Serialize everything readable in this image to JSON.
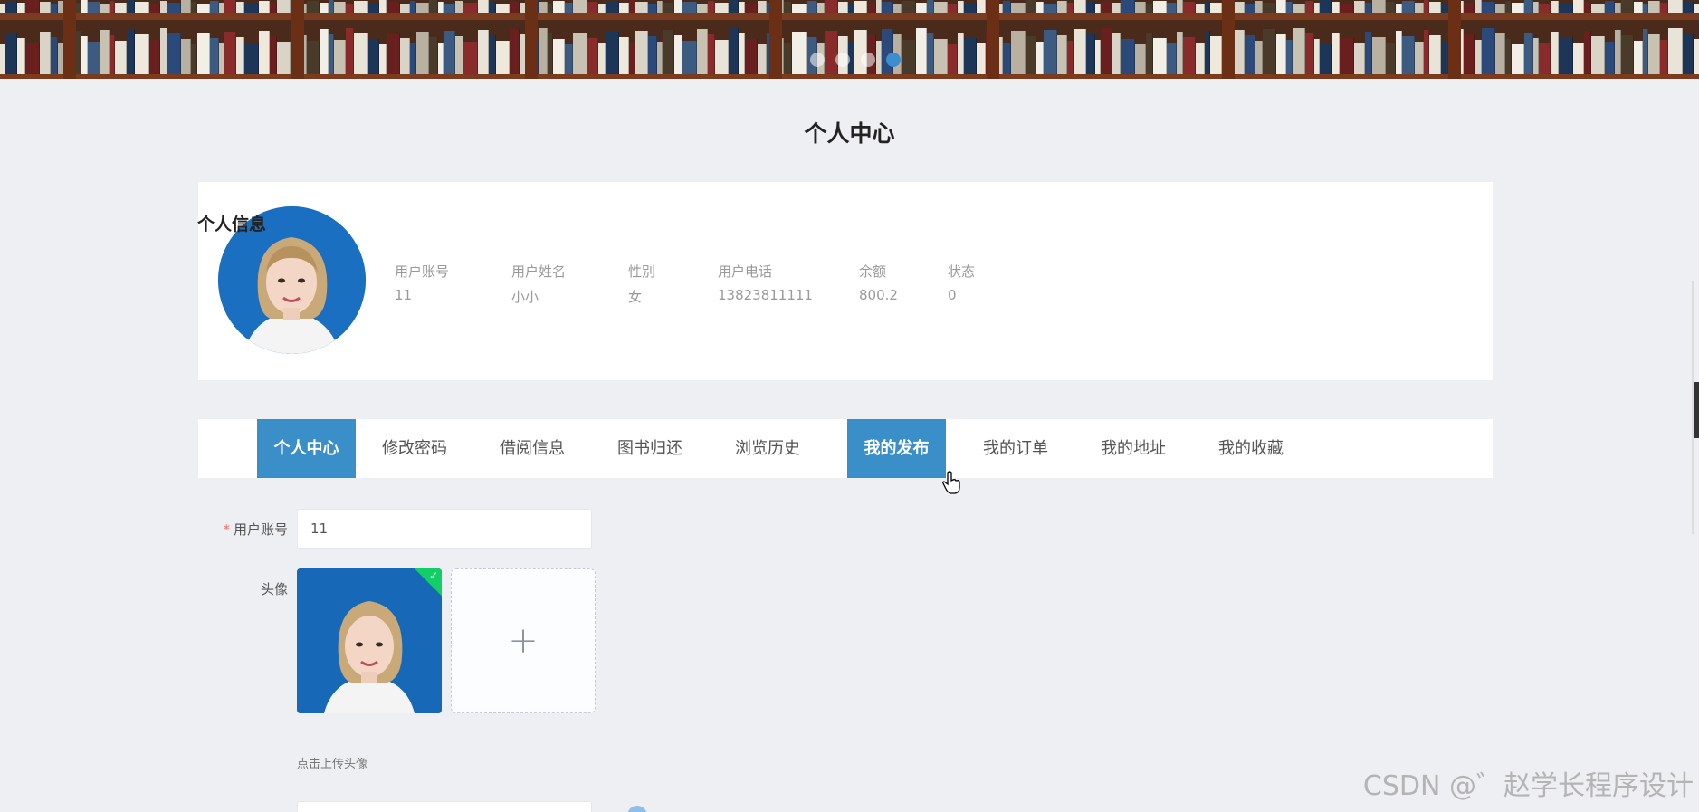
{
  "page": {
    "title": "个人中心"
  },
  "banner": {
    "slide_count": 4,
    "active_slide": 4
  },
  "profile": {
    "section_title": "个人信息",
    "fields": [
      {
        "label": "用户账号",
        "value": "11"
      },
      {
        "label": "用户姓名",
        "value": "小小"
      },
      {
        "label": "性别",
        "value": "女"
      },
      {
        "label": "用户电话",
        "value": "13823811111"
      },
      {
        "label": "余额",
        "value": "800.2"
      },
      {
        "label": "状态",
        "value": "0"
      }
    ]
  },
  "tabs": [
    {
      "label": "个人中心",
      "active": true
    },
    {
      "label": "修改密码",
      "active": false
    },
    {
      "label": "借阅信息",
      "active": false
    },
    {
      "label": "图书归还",
      "active": false
    },
    {
      "label": "浏览历史",
      "active": false
    },
    {
      "label": "我的发布",
      "active": true
    },
    {
      "label": "我的订单",
      "active": false
    },
    {
      "label": "我的地址",
      "active": false
    },
    {
      "label": "我的收藏",
      "active": false
    }
  ],
  "form": {
    "account": {
      "required_mark": "*",
      "label": "用户账号",
      "value": "11"
    },
    "avatar": {
      "label": "头像",
      "hint": "点击上传头像",
      "upload_icon": "+",
      "uploaded_check": "✓"
    }
  },
  "watermark": "CSDN @゛赵学长程序设计",
  "colors": {
    "accent": "#3a8fc8",
    "success": "#13ce66",
    "required": "#f56c6c"
  }
}
